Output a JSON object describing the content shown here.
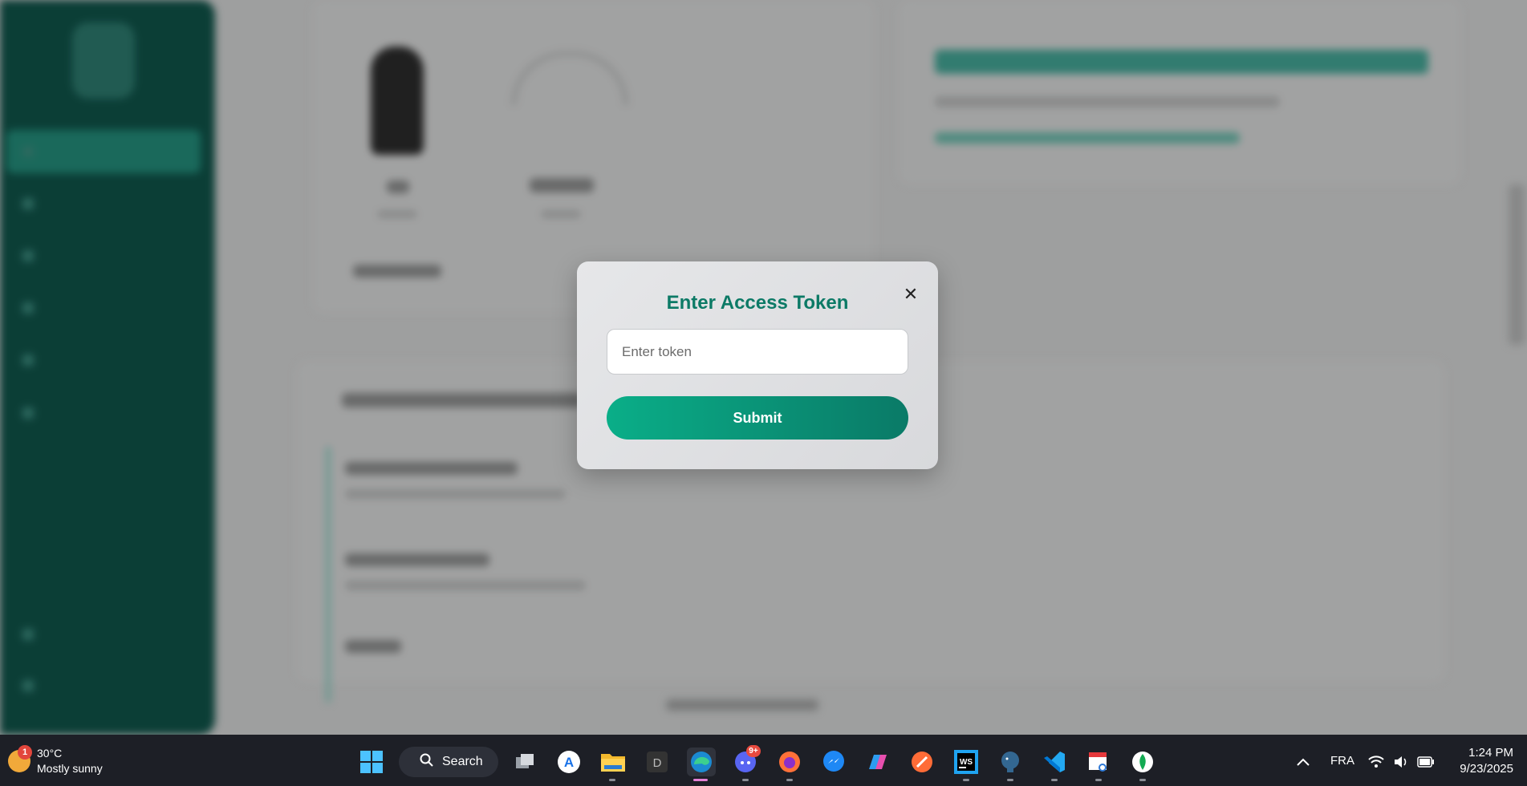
{
  "modal": {
    "title": "Enter Access Token",
    "input_placeholder": "Enter token",
    "input_value": "",
    "submit_label": "Submit",
    "close_glyph": "✕"
  },
  "taskbar": {
    "weather": {
      "badge": "1",
      "temp": "30°C",
      "condition": "Mostly sunny"
    },
    "search_label": "Search",
    "discord_badge": "9+",
    "language": "FRA",
    "time": "1:24 PM",
    "date": "9/23/2025"
  },
  "colors": {
    "accent": "#0c7a66",
    "submit_gradient_start": "#0aae88",
    "submit_gradient_end": "#0a7a67",
    "sidebar": "#053c34",
    "taskbar": "#1d1f26"
  },
  "icons": [
    "windows-start-icon",
    "search-icon",
    "task-view-icon",
    "app-store-icon",
    "file-explorer-icon",
    "d-app-icon",
    "edge-icon",
    "discord-icon",
    "firefox-icon",
    "messenger-icon",
    "copilot-icon",
    "postman-icon",
    "webstorm-icon",
    "postgresql-icon",
    "vscode-icon",
    "snipping-tool-icon",
    "mongodb-icon",
    "chevron-up-icon",
    "wifi-icon",
    "speaker-icon",
    "battery-icon"
  ]
}
